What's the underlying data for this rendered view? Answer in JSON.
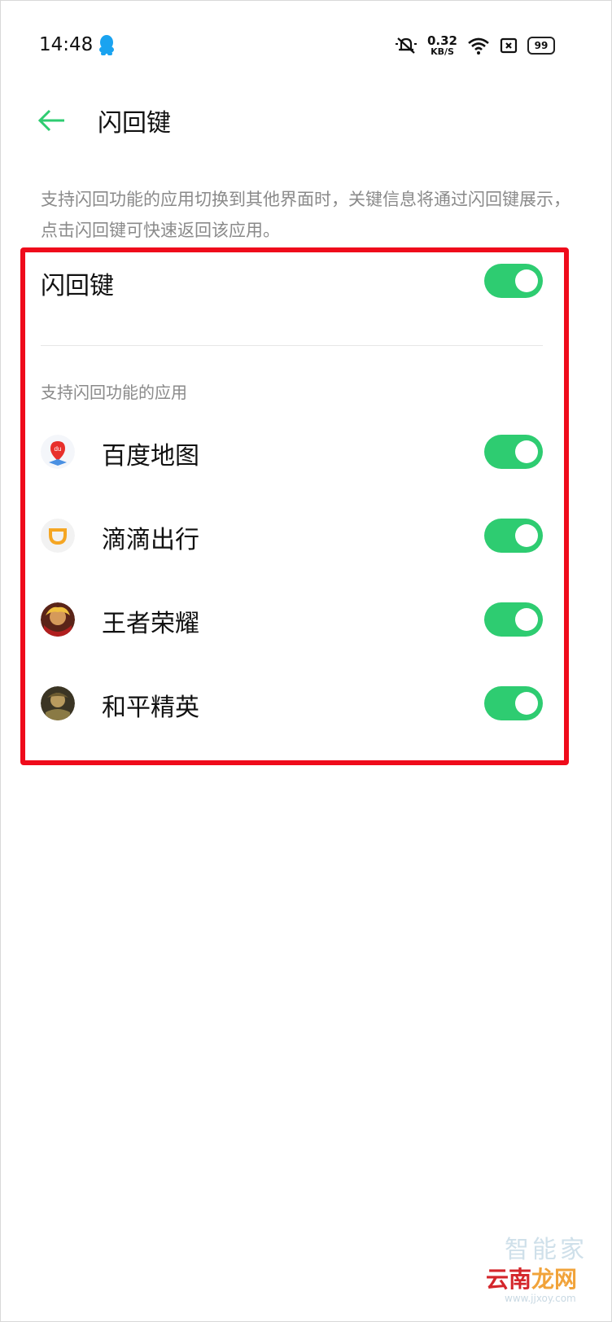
{
  "status_bar": {
    "time": "14:48",
    "net_speed_value": "0.32",
    "net_speed_unit": "KB/S",
    "battery": "99"
  },
  "header": {
    "title": "闪回键",
    "back_icon": "arrow-left-icon"
  },
  "description": "支持闪回功能的应用切换到其他界面时，关键信息将通过闪回键展示，点击闪回键可快速返回该应用。",
  "main_toggle": {
    "label": "闪回键",
    "enabled": true
  },
  "section_label": "支持闪回功能的应用",
  "apps": [
    {
      "name": "百度地图",
      "icon": "baidu-map-icon",
      "enabled": true
    },
    {
      "name": "滴滴出行",
      "icon": "didi-icon",
      "enabled": true
    },
    {
      "name": "王者荣耀",
      "icon": "honor-of-kings-icon",
      "enabled": true
    },
    {
      "name": "和平精英",
      "icon": "peacekeeper-elite-icon",
      "enabled": true
    }
  ],
  "colors": {
    "accent": "#2ecc71",
    "highlight": "#ef0b1b",
    "secondary_text": "#8a8a8a"
  },
  "watermark": {
    "line1": "智能家",
    "line2a": "云南",
    "line2b": "龙网",
    "line3": "www.jjxoy.com"
  }
}
